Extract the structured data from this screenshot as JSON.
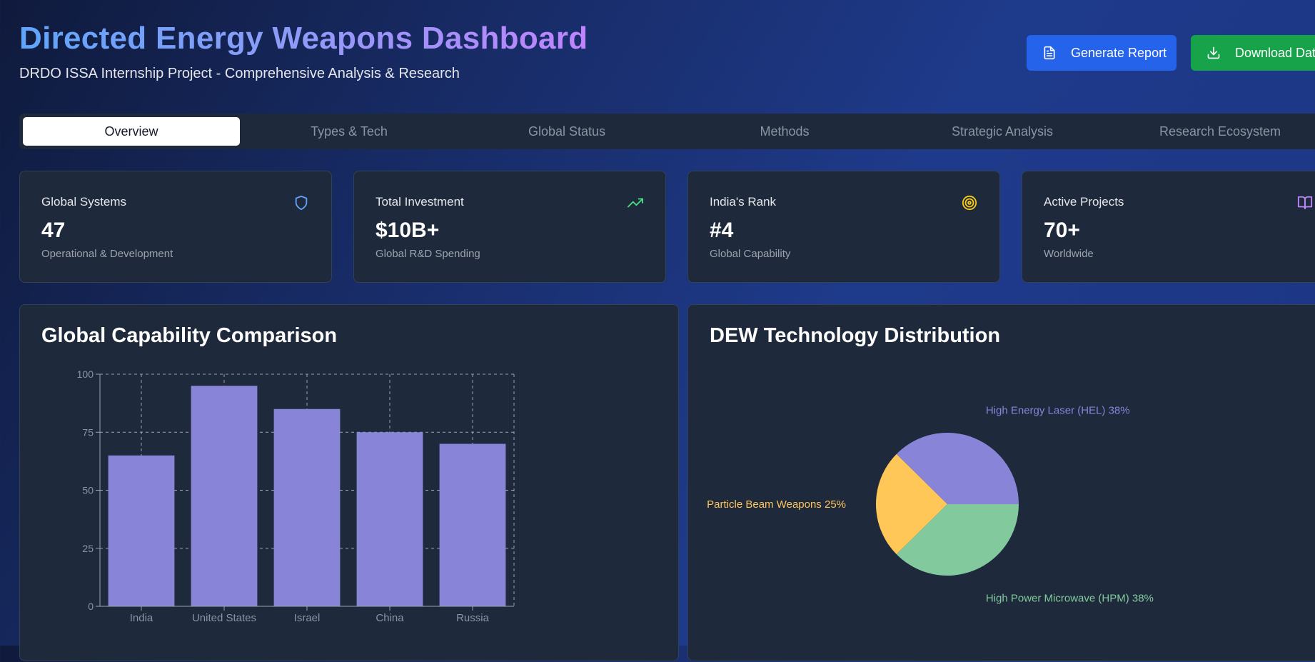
{
  "header": {
    "title": "Directed Energy Weapons Dashboard",
    "subtitle": "DRDO ISSA Internship Project - Comprehensive Analysis & Research"
  },
  "actions": {
    "generate_report": "Generate Report",
    "download_data": "Download Data"
  },
  "tabs": [
    {
      "label": "Overview",
      "active": true
    },
    {
      "label": "Types & Tech",
      "active": false
    },
    {
      "label": "Global Status",
      "active": false
    },
    {
      "label": "Methods",
      "active": false
    },
    {
      "label": "Strategic Analysis",
      "active": false
    },
    {
      "label": "Research Ecosystem",
      "active": false
    }
  ],
  "stats": [
    {
      "label": "Global Systems",
      "value": "47",
      "sub": "Operational & Development",
      "icon": "shield-icon",
      "icon_color": "#60a5fa"
    },
    {
      "label": "Total Investment",
      "value": "$10B+",
      "sub": "Global R&D Spending",
      "icon": "trending-up-icon",
      "icon_color": "#4ade80"
    },
    {
      "label": "India's Rank",
      "value": "#4",
      "sub": "Global Capability",
      "icon": "target-icon",
      "icon_color": "#facc15"
    },
    {
      "label": "Active Projects",
      "value": "70+",
      "sub": "Worldwide",
      "icon": "book-icon",
      "icon_color": "#c084fc"
    }
  ],
  "panels": {
    "capability_title": "Global Capability Comparison",
    "distribution_title": "DEW Technology Distribution"
  },
  "colors": {
    "bar": "#8884d8",
    "hel": "#8884d8",
    "hpm": "#82ca9d",
    "particle": "#ffc658",
    "grid": "#9ca3af",
    "tick": "#8b94a3"
  },
  "chart_data": [
    {
      "type": "bar",
      "title": "Global Capability Comparison",
      "categories": [
        "India",
        "United States",
        "Israel",
        "China",
        "Russia"
      ],
      "values": [
        65,
        95,
        85,
        75,
        70
      ],
      "ylim": [
        0,
        100
      ],
      "yticks": [
        0,
        25,
        50,
        75,
        100
      ],
      "grid": true,
      "xlabel": "",
      "ylabel": ""
    },
    {
      "type": "pie",
      "title": "DEW Technology Distribution",
      "slices": [
        {
          "label": "High Energy Laser (HEL) 38%",
          "value": 38,
          "color": "#8884d8"
        },
        {
          "label": "Particle Beam Weapons 25%",
          "value": 25,
          "color": "#ffc658"
        },
        {
          "label": "High Power Microwave (HPM) 38%",
          "value": 38,
          "color": "#82ca9d"
        }
      ]
    }
  ]
}
